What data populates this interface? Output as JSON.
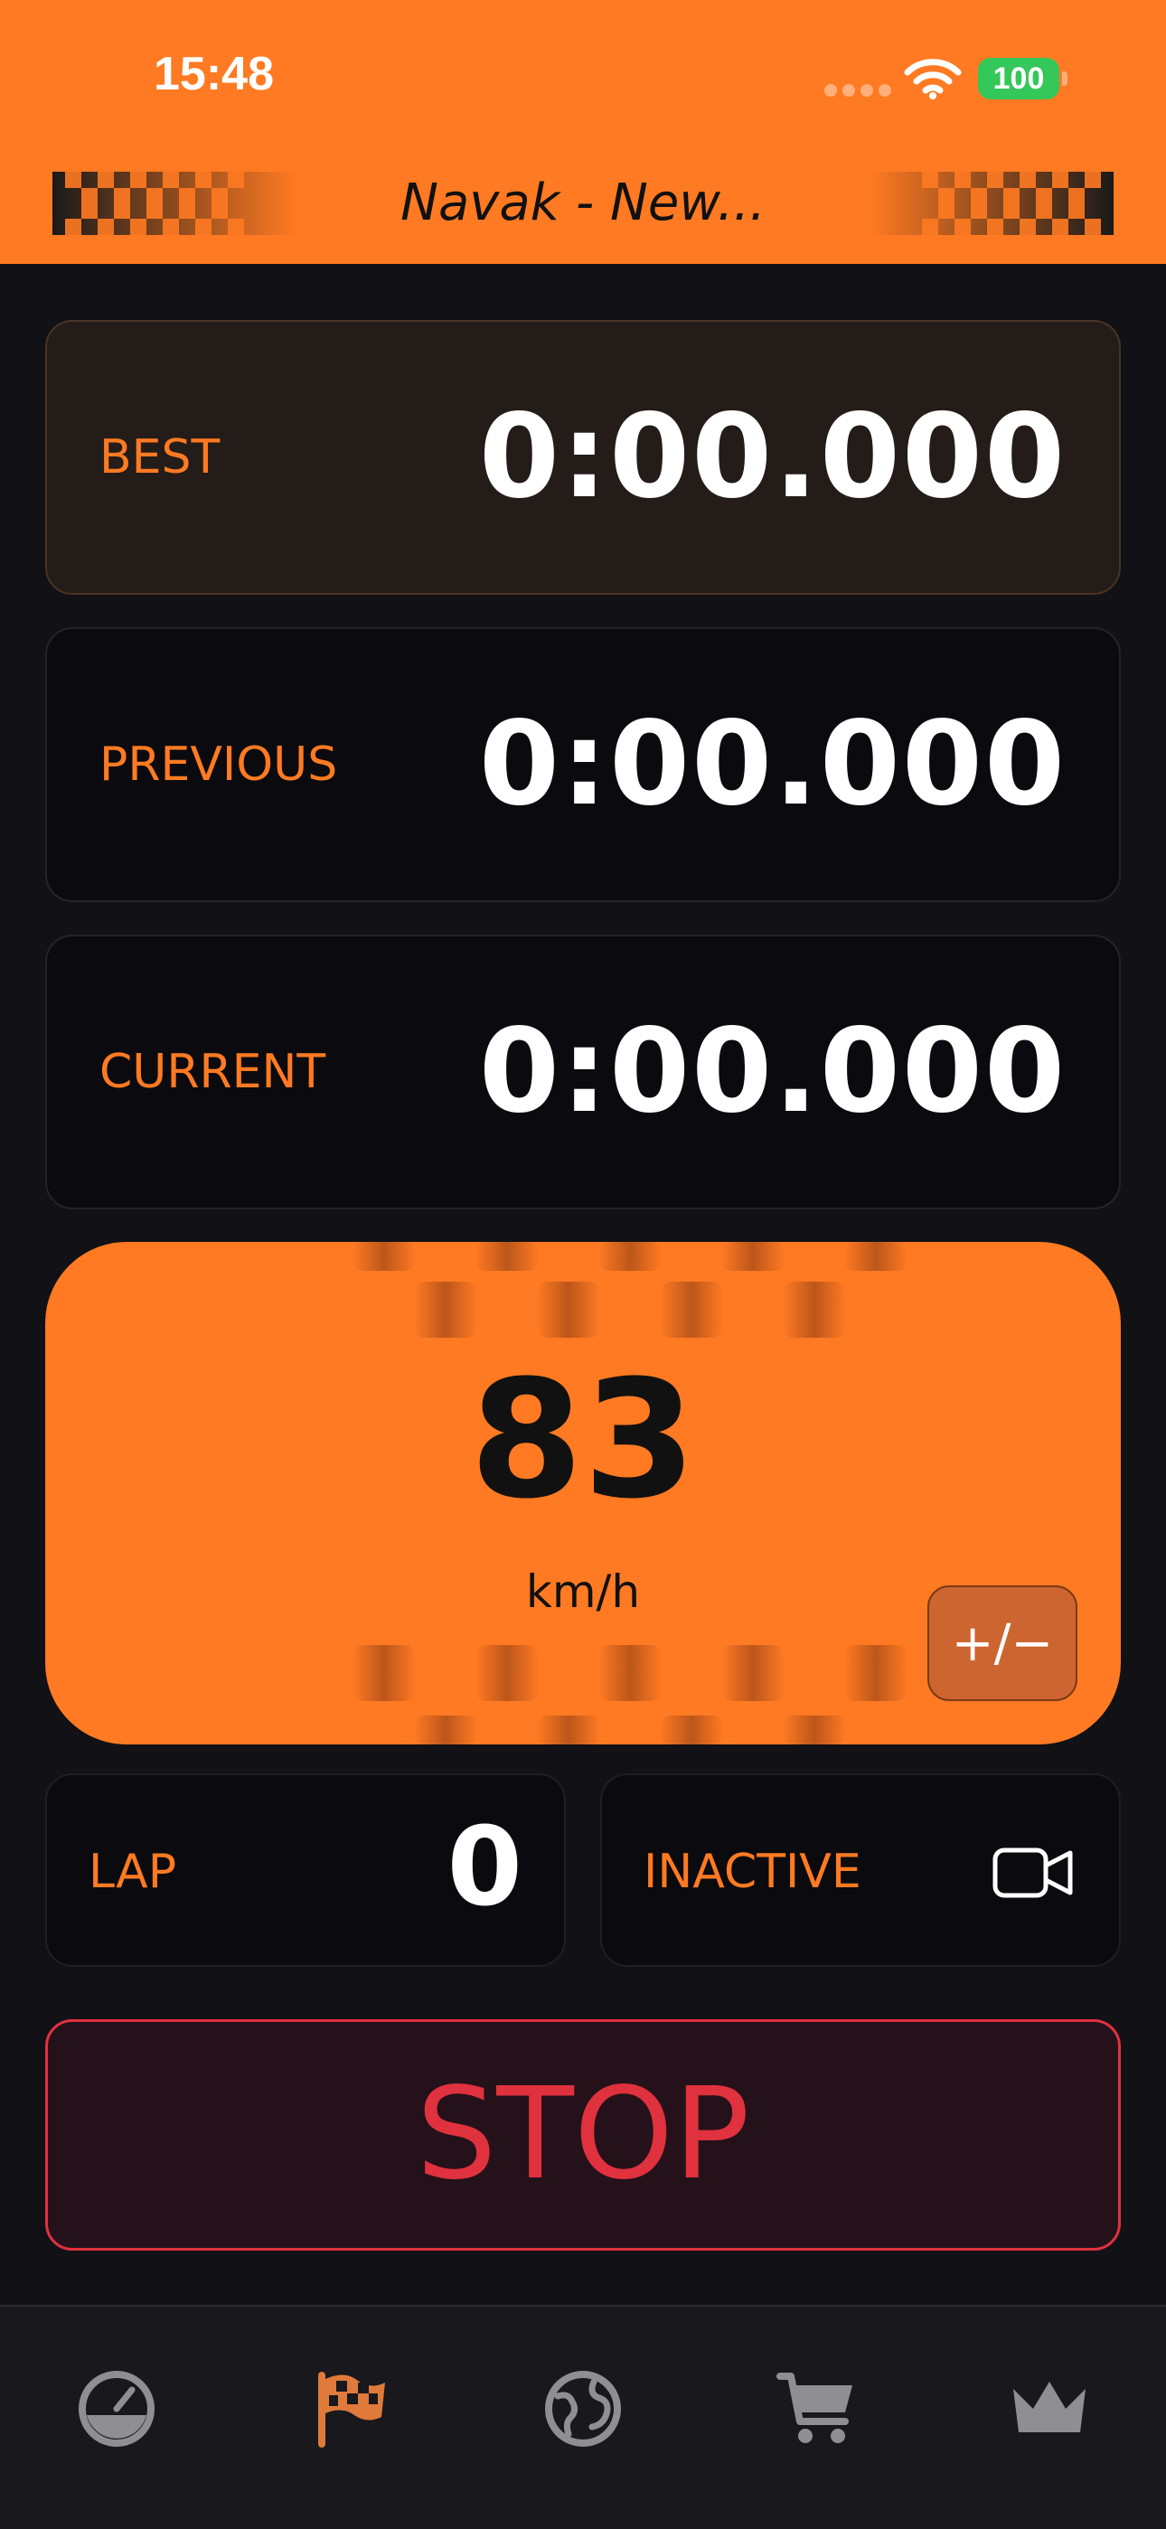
{
  "status_bar": {
    "time": "15:48",
    "battery": "100"
  },
  "header": {
    "title": "Navak - New..."
  },
  "timers": [
    {
      "label": "BEST",
      "value": "0:00.000"
    },
    {
      "label": "PREVIOUS",
      "value": "0:00.000"
    },
    {
      "label": "CURRENT",
      "value": "0:00.000"
    }
  ],
  "speed": {
    "value": "83",
    "unit": "km/h",
    "adjust_label": "+/−"
  },
  "lap": {
    "label": "LAP",
    "value": "0"
  },
  "recording": {
    "label": "INACTIVE",
    "icon": "video-camera-icon"
  },
  "stop_button": {
    "label": "STOP"
  },
  "tabbar": {
    "tabs": [
      {
        "icon": "speedometer-icon",
        "active": false
      },
      {
        "icon": "checkered-flag-icon",
        "active": true
      },
      {
        "icon": "globe-icon",
        "active": false
      },
      {
        "icon": "cart-icon",
        "active": false
      },
      {
        "icon": "crown-icon",
        "active": false
      }
    ]
  },
  "colors": {
    "accent": "#FF7A22",
    "background": "#111116",
    "stop": "#E0313E",
    "tab_inactive": "#8E8E93",
    "battery": "#34C759"
  }
}
